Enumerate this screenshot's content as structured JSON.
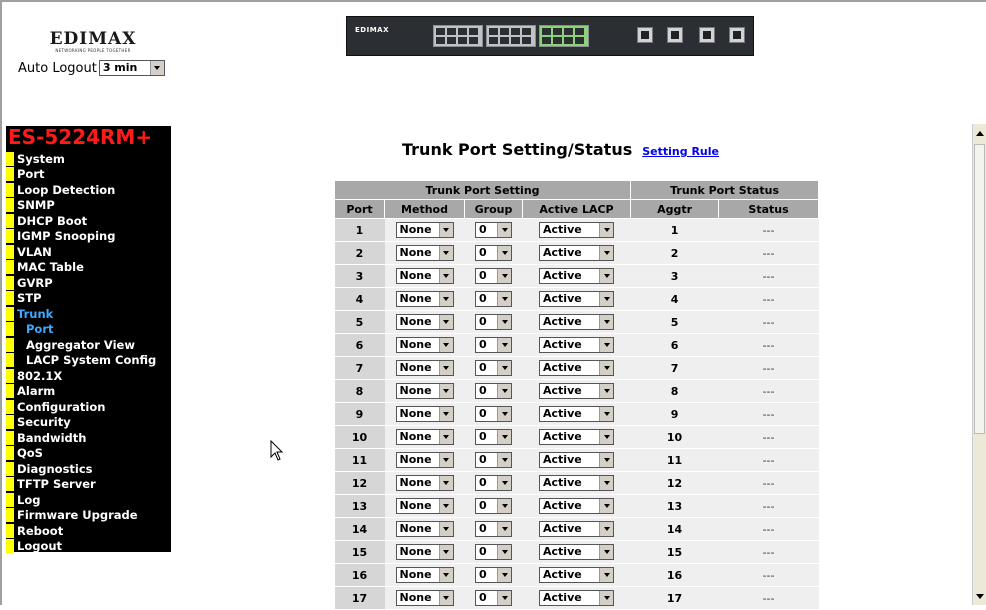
{
  "header": {
    "brand": "EDIMAX",
    "tagline": "NETWORKING PEOPLE TOGETHER",
    "auto_logout_label": "Auto Logout",
    "auto_logout_value": "3 min",
    "switch_brand": "EDIMAX"
  },
  "sidebar": {
    "model": "ES-5224RM+",
    "items": [
      {
        "label": "System"
      },
      {
        "label": "Port"
      },
      {
        "label": "Loop Detection"
      },
      {
        "label": "SNMP"
      },
      {
        "label": "DHCP Boot"
      },
      {
        "label": "IGMP Snooping"
      },
      {
        "label": "VLAN"
      },
      {
        "label": "MAC Table"
      },
      {
        "label": "GVRP"
      },
      {
        "label": "STP"
      },
      {
        "label": "Trunk"
      },
      {
        "label": "Port"
      },
      {
        "label": "Aggregator View"
      },
      {
        "label": "LACP System Config"
      },
      {
        "label": "802.1X"
      },
      {
        "label": "Alarm"
      },
      {
        "label": "Configuration"
      },
      {
        "label": "Security"
      },
      {
        "label": "Bandwidth"
      },
      {
        "label": "QoS"
      },
      {
        "label": "Diagnostics"
      },
      {
        "label": "TFTP Server"
      },
      {
        "label": "Log"
      },
      {
        "label": "Firmware Upgrade"
      },
      {
        "label": "Reboot"
      },
      {
        "label": "Logout"
      }
    ],
    "active_color": "#3fa9ff",
    "marker_color": "#ffff00",
    "model_color": "#ff1a1a"
  },
  "main": {
    "title": "Trunk Port Setting/Status",
    "setting_rule_link": "Setting Rule",
    "table": {
      "group_setting": "Trunk Port Setting",
      "group_status": "Trunk Port Status",
      "columns": [
        "Port",
        "Method",
        "Group",
        "Active LACP",
        "Aggtr",
        "Status"
      ],
      "rows": [
        {
          "port": "1",
          "method": "None",
          "group": "0",
          "lacp": "Active",
          "aggtr": "1",
          "status": "---"
        },
        {
          "port": "2",
          "method": "None",
          "group": "0",
          "lacp": "Active",
          "aggtr": "2",
          "status": "---"
        },
        {
          "port": "3",
          "method": "None",
          "group": "0",
          "lacp": "Active",
          "aggtr": "3",
          "status": "---"
        },
        {
          "port": "4",
          "method": "None",
          "group": "0",
          "lacp": "Active",
          "aggtr": "4",
          "status": "---"
        },
        {
          "port": "5",
          "method": "None",
          "group": "0",
          "lacp": "Active",
          "aggtr": "5",
          "status": "---"
        },
        {
          "port": "6",
          "method": "None",
          "group": "0",
          "lacp": "Active",
          "aggtr": "6",
          "status": "---"
        },
        {
          "port": "7",
          "method": "None",
          "group": "0",
          "lacp": "Active",
          "aggtr": "7",
          "status": "---"
        },
        {
          "port": "8",
          "method": "None",
          "group": "0",
          "lacp": "Active",
          "aggtr": "8",
          "status": "---"
        },
        {
          "port": "9",
          "method": "None",
          "group": "0",
          "lacp": "Active",
          "aggtr": "9",
          "status": "---"
        },
        {
          "port": "10",
          "method": "None",
          "group": "0",
          "lacp": "Active",
          "aggtr": "10",
          "status": "---"
        },
        {
          "port": "11",
          "method": "None",
          "group": "0",
          "lacp": "Active",
          "aggtr": "11",
          "status": "---"
        },
        {
          "port": "12",
          "method": "None",
          "group": "0",
          "lacp": "Active",
          "aggtr": "12",
          "status": "---"
        },
        {
          "port": "13",
          "method": "None",
          "group": "0",
          "lacp": "Active",
          "aggtr": "13",
          "status": "---"
        },
        {
          "port": "14",
          "method": "None",
          "group": "0",
          "lacp": "Active",
          "aggtr": "14",
          "status": "---"
        },
        {
          "port": "15",
          "method": "None",
          "group": "0",
          "lacp": "Active",
          "aggtr": "15",
          "status": "---"
        },
        {
          "port": "16",
          "method": "None",
          "group": "0",
          "lacp": "Active",
          "aggtr": "16",
          "status": "---"
        },
        {
          "port": "17",
          "method": "None",
          "group": "0",
          "lacp": "Active",
          "aggtr": "17",
          "status": "---"
        }
      ]
    }
  },
  "icons": {
    "dropdown": "chevron-down-icon",
    "cursor": "mouse-pointer-icon",
    "scroll_up": "scroll-up-icon",
    "scroll_down": "scroll-down-icon"
  }
}
